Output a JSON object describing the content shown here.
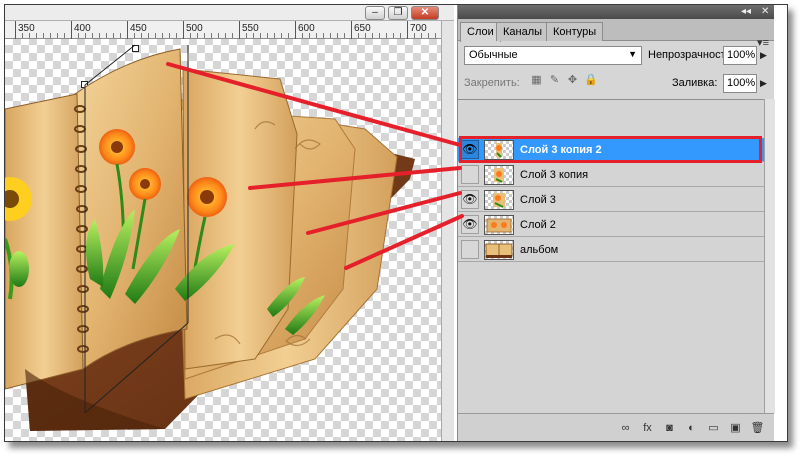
{
  "ruler": {
    "labels": [
      "350",
      "400",
      "450",
      "500",
      "550",
      "600",
      "650",
      "700"
    ]
  },
  "window_controls": {
    "minimize_glyph": "–",
    "restore_glyph": "❐",
    "close_glyph": "✕"
  },
  "panel": {
    "collapse_glyph": "◂◂",
    "close_glyph": "✕",
    "menu_glyph": "▾≡",
    "tabs": [
      {
        "label": "Слои",
        "active": true
      },
      {
        "label": "Каналы",
        "active": false
      },
      {
        "label": "Контуры",
        "active": false
      }
    ],
    "blend_mode": "Обычные",
    "opacity_label": "Непрозрачность:",
    "opacity_value": "100%",
    "lock_label": "Закрепить:",
    "fill_label": "Заливка:",
    "fill_value": "100%",
    "dropdown_arrow": "▶",
    "layers": [
      {
        "name": "Слой 3 копия 2",
        "visible": true,
        "selected": true,
        "thumb": "flower"
      },
      {
        "name": "Слой 3 копия",
        "visible": false,
        "selected": false,
        "thumb": "flower"
      },
      {
        "name": "Слой 3",
        "visible": true,
        "selected": false,
        "thumb": "flower"
      },
      {
        "name": "Слой 2",
        "visible": true,
        "selected": false,
        "thumb": "pages"
      },
      {
        "name": "альбом",
        "visible": false,
        "selected": false,
        "thumb": "album"
      }
    ],
    "footer_icons": [
      {
        "name": "link-layers-icon",
        "glyph": "∞"
      },
      {
        "name": "layer-style-icon",
        "glyph": "fx"
      },
      {
        "name": "add-mask-icon",
        "glyph": "◙"
      },
      {
        "name": "adjustment-layer-icon",
        "glyph": "◐"
      },
      {
        "name": "new-group-icon",
        "glyph": "▭"
      },
      {
        "name": "new-layer-icon",
        "glyph": "▣"
      },
      {
        "name": "delete-layer-icon",
        "glyph": "🗑"
      }
    ]
  },
  "colors": {
    "selected_layer": "#3399ff",
    "annotation_red": "#e5202a",
    "panel_bg": "#d6d6d6"
  }
}
